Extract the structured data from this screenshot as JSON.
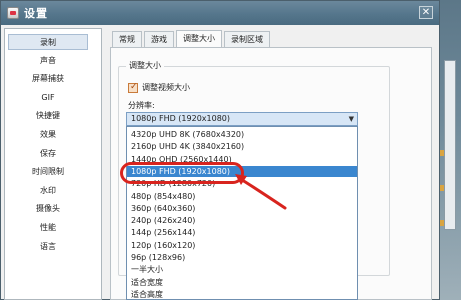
{
  "window": {
    "title": "设置",
    "close_glyph": "✕"
  },
  "nav": {
    "items": [
      {
        "label": "录制",
        "active": true
      },
      {
        "label": "声音"
      },
      {
        "label": "屏幕捕获"
      },
      {
        "label": "GIF"
      },
      {
        "label": "快捷键"
      },
      {
        "label": "效果"
      },
      {
        "label": "保存"
      },
      {
        "label": "时间限制"
      },
      {
        "label": "水印"
      },
      {
        "label": "摄像头"
      },
      {
        "label": "性能"
      },
      {
        "label": "语言"
      }
    ]
  },
  "tabs": [
    {
      "label": "常规"
    },
    {
      "label": "游戏"
    },
    {
      "label": "调整大小",
      "active": true
    },
    {
      "label": "录制区域"
    }
  ],
  "resize": {
    "group_title": "调整大小",
    "checkbox_label": "调整视频大小",
    "checkbox_checked": true,
    "resolution_label": "分辨率:",
    "selected_value": "1080p FHD (1920x1080)",
    "options": [
      "4320p UHD 8K (7680x4320)",
      "2160p UHD 4K (3840x2160)",
      "1440p QHD (2560x1440)",
      "1080p FHD (1920x1080)",
      "720p HD (1280x720)",
      "480p (854x480)",
      "360p (640x360)",
      "240p (426x240)",
      "144p (256x144)",
      "120p (160x120)",
      "96p (128x96)",
      "一半大小",
      "适合宽度",
      "适合高度"
    ],
    "highlighted_index": 3
  },
  "colors": {
    "accent": "#3a86cf",
    "annotation": "#d8241e",
    "titlebar": "#55768c"
  }
}
